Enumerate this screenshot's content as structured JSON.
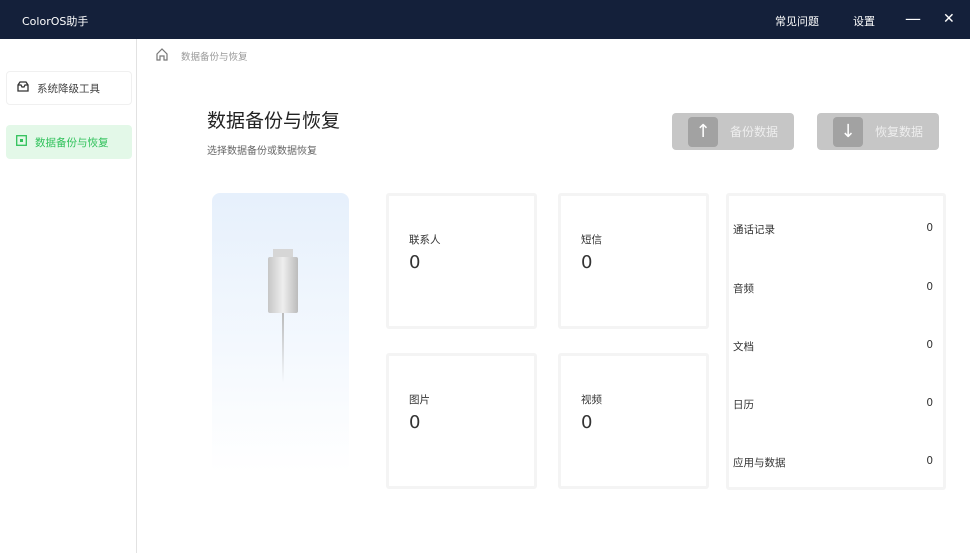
{
  "titlebar": {
    "title": "ColorOS助手",
    "faq": "常见问题",
    "settings": "设置",
    "minimize": "—",
    "close": "✕"
  },
  "sidebar": {
    "items": [
      {
        "label": "系统降级工具",
        "icon": "inbox-icon"
      },
      {
        "label": "数据备份与恢复",
        "icon": "square-dot-icon",
        "active": true
      }
    ]
  },
  "breadcrumb": {
    "current": "数据备份与恢复"
  },
  "main": {
    "title": "数据备份与恢复",
    "subtitle": "选择数据备份或数据恢复",
    "backup_label": "备份数据",
    "restore_label": "恢复数据",
    "cards": [
      {
        "label": "联系人",
        "value": "0"
      },
      {
        "label": "短信",
        "value": "0"
      },
      {
        "label": "图片",
        "value": "0"
      },
      {
        "label": "视频",
        "value": "0"
      }
    ],
    "list": [
      {
        "label": "通话记录",
        "value": "0"
      },
      {
        "label": "音频",
        "value": "0"
      },
      {
        "label": "文档",
        "value": "0"
      },
      {
        "label": "日历",
        "value": "0"
      },
      {
        "label": "应用与数据",
        "value": "0"
      }
    ]
  },
  "colors": {
    "titlebar": "#14203a",
    "accent": "#2fc15a",
    "button_disabled": "#c6c6c6"
  }
}
